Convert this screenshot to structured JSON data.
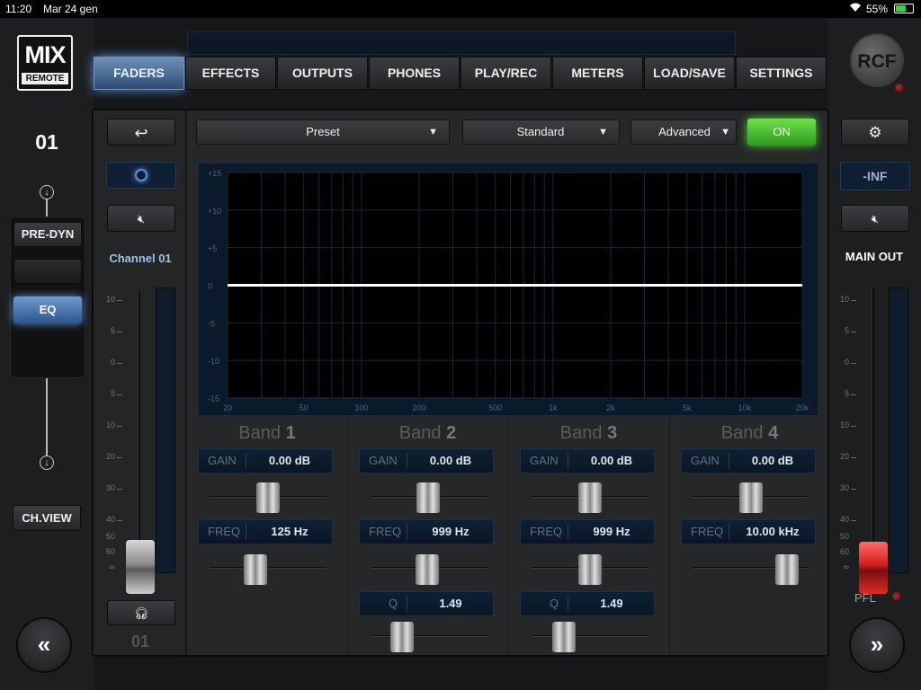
{
  "status": {
    "time": "11:20",
    "date": "Mar 24 gen",
    "battery": "55%"
  },
  "brand": {
    "logo_top": "MIX",
    "logo_bottom": "REMOTE",
    "right_logo": "RCF"
  },
  "tabs": [
    "FADERS",
    "EFFECTS",
    "OUTPUTS",
    "PHONES",
    "PLAY/REC",
    "METERS",
    "LOAD/SAVE",
    "SETTINGS"
  ],
  "active_tab": "FADERS",
  "left": {
    "channel_number": "01",
    "pre_dyn": "PRE-DYN",
    "eq": "EQ",
    "ch_view": "CH.VIEW",
    "nav_prev": "«"
  },
  "channel_strip": {
    "name": "Channel 01",
    "footer_number": "01",
    "scale": [
      "10",
      "5",
      "0",
      "5",
      "10",
      "20",
      "30",
      "40",
      "50",
      "60",
      "∞"
    ]
  },
  "toolbar": {
    "preset": "Preset",
    "standard": "Standard",
    "advanced": "Advanced",
    "on": "ON"
  },
  "graph": {
    "y_labels": [
      "+15",
      "+10",
      "+5",
      "0",
      "-5",
      "-10",
      "-15"
    ],
    "x_labels": [
      "20",
      "50",
      "100",
      "200",
      "500",
      "1k",
      "2k",
      "5k",
      "10k",
      "20k"
    ],
    "response_db": 0
  },
  "bands": [
    {
      "title_word": "Band",
      "title_num": "1",
      "gain_label": "GAIN",
      "gain": "0.00 dB",
      "freq_label": "FREQ",
      "freq": "125 Hz",
      "q_label": "",
      "q": ""
    },
    {
      "title_word": "Band",
      "title_num": "2",
      "gain_label": "GAIN",
      "gain": "0.00 dB",
      "freq_label": "FREQ",
      "freq": "999 Hz",
      "q_label": "Q",
      "q": "1.49"
    },
    {
      "title_word": "Band",
      "title_num": "3",
      "gain_label": "GAIN",
      "gain": "0.00 dB",
      "freq_label": "FREQ",
      "freq": "999 Hz",
      "q_label": "Q",
      "q": "1.49"
    },
    {
      "title_word": "Band",
      "title_num": "4",
      "gain_label": "GAIN",
      "gain": "0.00 dB",
      "freq_label": "FREQ",
      "freq": "10.00 kHz",
      "q_label": "",
      "q": ""
    }
  ],
  "right": {
    "level": "-INF",
    "main_out": "MAIN OUT",
    "pfl": "PFL",
    "nav_next": "»"
  },
  "colors": {
    "accent_blue": "#5b8fd6",
    "on_green": "#52d02e",
    "fader_red": "#e03030"
  }
}
